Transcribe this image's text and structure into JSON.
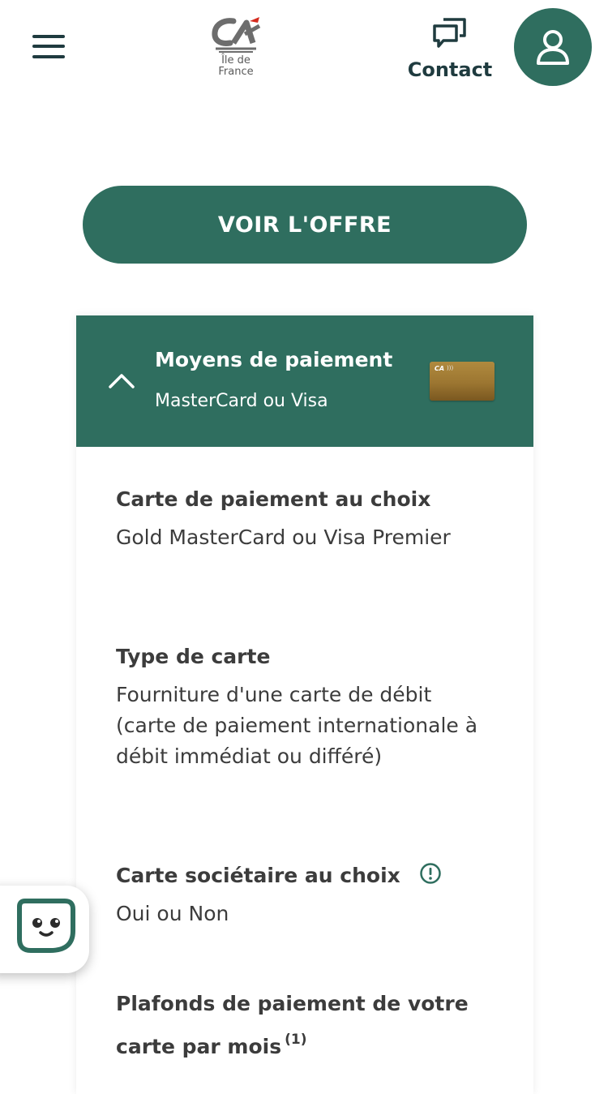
{
  "header": {
    "logo_text": "CA",
    "logo_region": "Île de\nFrance",
    "contact_label": "Contact"
  },
  "cta": {
    "label": "VOIR L'OFFRE"
  },
  "accordion": {
    "title": "Moyens de paiement",
    "subtitle": "MasterCard ou Visa",
    "expanded": true,
    "card_image_label": "CA",
    "sections": [
      {
        "title": "Carte de paiement au choix",
        "value": "Gold MasterCard ou Visa Premier"
      },
      {
        "title": "Type de carte",
        "value": "Fourniture d'une carte de débit (carte de paiement internationale à débit immédiat ou différé)"
      },
      {
        "title": "Carte sociétaire au choix",
        "value": "Oui ou Non",
        "has_info_icon": true
      },
      {
        "title": "Plafonds de paiement de votre carte par mois",
        "footnote": "(1)"
      }
    ]
  },
  "colors": {
    "brand_green": "#2f6e5f",
    "dark_navy": "#1f3b3f",
    "text": "#3c3c3c",
    "card_gold": "#a9843a"
  },
  "icons": {
    "menu": "hamburger-menu-icon",
    "contact": "chat-bubbles-icon",
    "account": "user-icon",
    "chevron": "chevron-up-icon",
    "info": "info-exclamation-icon",
    "chatbot": "chatbot-face-icon"
  }
}
